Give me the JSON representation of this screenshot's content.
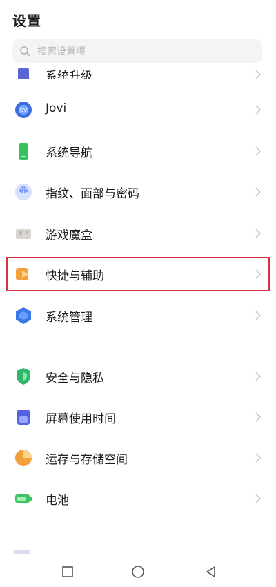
{
  "header": {
    "title": "设置"
  },
  "search": {
    "placeholder": "搜索设置项"
  },
  "settings": {
    "items": [
      {
        "label": "系统升级",
        "icon": "system-update-icon",
        "color": "#5b63d6"
      },
      {
        "label": "Jovi",
        "icon": "jovi-icon",
        "color": "#3d6fe0"
      },
      {
        "label": "系统导航",
        "icon": "phone-navigation-icon",
        "color": "#35c25c"
      },
      {
        "label": "指纹、面部与密码",
        "icon": "fingerprint-icon",
        "color": "#6c8cf0"
      },
      {
        "label": "游戏魔盒",
        "icon": "game-box-icon",
        "color": "#c7c1bd"
      },
      {
        "label": "快捷与辅助",
        "icon": "shortcut-icon",
        "color": "#f4a13a"
      },
      {
        "label": "系统管理",
        "icon": "hexagon-icon",
        "color": "#3b78e7"
      },
      {
        "label": "安全与隐私",
        "icon": "shield-icon",
        "color": "#2fb86a"
      },
      {
        "label": "屏幕使用时间",
        "icon": "hourglass-icon",
        "color": "#5262e0"
      },
      {
        "label": "运存与存储空间",
        "icon": "pie-chart-icon",
        "color": "#f2a03b"
      },
      {
        "label": "电池",
        "icon": "battery-icon",
        "color": "#3cc361"
      }
    ]
  },
  "highlight": {
    "color": "#d9343e",
    "item": "快捷与辅助"
  },
  "navbar": {
    "buttons": [
      "recent-apps-icon",
      "home-icon",
      "back-icon"
    ]
  }
}
